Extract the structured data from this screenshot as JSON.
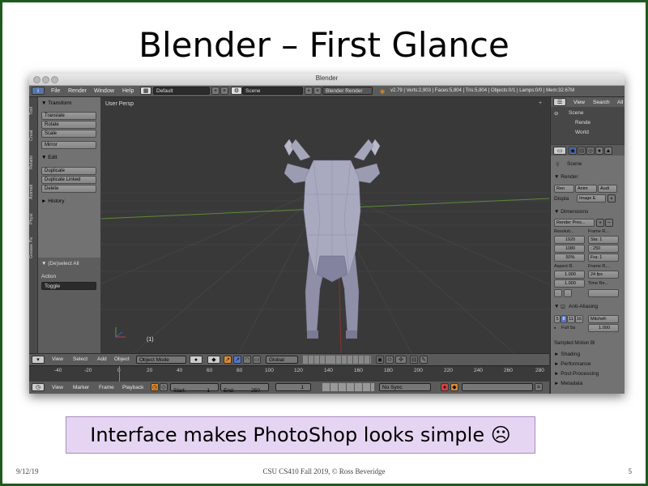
{
  "slide": {
    "title": "Blender – First Glance",
    "caption": "Interface makes PhotoShop looks simple ☹",
    "footer_date": "9/12/19",
    "footer_center": "CSU CS410 Fall 2019, © Ross Beveridge",
    "page_number": "5"
  },
  "blender": {
    "window_title": "Blender",
    "menu": {
      "file": "File",
      "render": "Render",
      "window": "Window",
      "help": "Help"
    },
    "layout": "Default",
    "scene": "Scene",
    "engine": "Blender Render",
    "stats": "v2.79 | Verts:2,903 | Faces:5,804 | Tris:5,804 | Objects:0/1 | Lamps:0/0 | Mem:32.67M",
    "tabs": [
      "Tool",
      "Creat",
      "Relatio",
      "Animati",
      "Physi",
      "Grease Pe"
    ],
    "toolshelf": {
      "transform_header": "▼ Transform",
      "transform_buttons": [
        "Translate",
        "Rotate",
        "Scale"
      ],
      "mirror": "Mirror",
      "edit_header": "▼ Edit",
      "edit_buttons": [
        "Duplicate",
        "Duplicate Linked",
        "Delete"
      ],
      "history_header": "► History",
      "deselect_header": "▼ (De)select All",
      "action_label": "Action",
      "toggle": "Toggle"
    },
    "viewport_label": "User Persp",
    "object_label": "(1)",
    "viewport_header": {
      "view": "View",
      "select": "Select",
      "add": "Add",
      "object": "Object",
      "mode": "Object Mode",
      "orientation": "Global"
    },
    "timeline_ticks": [
      "-40",
      "-20",
      "0",
      "20",
      "40",
      "60",
      "80",
      "100",
      "120",
      "140",
      "160",
      "180",
      "200",
      "220",
      "240",
      "260",
      "280"
    ],
    "timeline_footer": {
      "view": "View",
      "marker": "Marker",
      "frame": "Frame",
      "playback": "Playback",
      "start": "Start:",
      "start_val": "1",
      "end": "End:",
      "end_val": "250",
      "current": "1",
      "sync": "No Sync"
    },
    "outliner": {
      "view": "View",
      "search": "Search",
      "all": "All",
      "items": [
        "Scene",
        "Rende",
        "World"
      ]
    },
    "properties": {
      "scene": "Scene",
      "render_header": "▼ Render",
      "render_buttons": [
        "Ren",
        "Anim",
        "Audi"
      ],
      "display_label": "Displa",
      "display_value": "Image E",
      "dimensions_header": "▼ Dimensions",
      "presets": "Render Pres...",
      "resolution_label": "Resoluti...",
      "res_x": "1920",
      "res_y": "1080",
      "res_pct": "50%",
      "frame_range_label": "Frame R...",
      "frame_start": "Sta: 1",
      "frame_end": ": 250",
      "frame_step": "Fra: 1",
      "aspect_label": "Aspect R.",
      "aspect_x": "1.000",
      "aspect_y": "1.000",
      "frame_rate_label": "Frame R...",
      "fps": "24 fps",
      "time_label": "Time Re...",
      "aa_header": "Anti-Aliasing",
      "aa_samples": [
        "5",
        "8",
        "11",
        "16"
      ],
      "aa_filter": "Mitchell-",
      "full_sample": "Full Sa",
      "filter_size": "1.000",
      "sampled_motion": "Sampled Motion Bl",
      "shading": "► Shading",
      "performance": "► Performance",
      "post_processing": "► Post Processing",
      "metadata": "► Metadata"
    }
  },
  "colors": {
    "accent_orange": "#e08a2c",
    "slide_border": "#1e5a1e",
    "caption_bg": "#e6d5f2"
  }
}
